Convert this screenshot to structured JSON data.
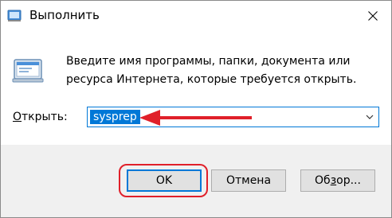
{
  "window": {
    "title": "Выполнить"
  },
  "dialog": {
    "description": "Введите имя программы, папки, документа или ресурса Интернета, которые требуется открыть.",
    "open_label_mnemonic": "О",
    "open_label_rest": "ткрыть:",
    "open_value": "sysprep"
  },
  "buttons": {
    "ok": "OK",
    "cancel": "Отмена",
    "browse_prefix": "Об",
    "browse_mnemonic": "з",
    "browse_suffix": "ор..."
  },
  "icons": {
    "title_icon": "run-icon",
    "close": "close-icon",
    "dropdown": "chevron-down-icon",
    "main": "run-program-icon"
  },
  "colors": {
    "accent": "#0078d7",
    "annotation": "#e0202a",
    "footer": "#f0f0f0"
  }
}
